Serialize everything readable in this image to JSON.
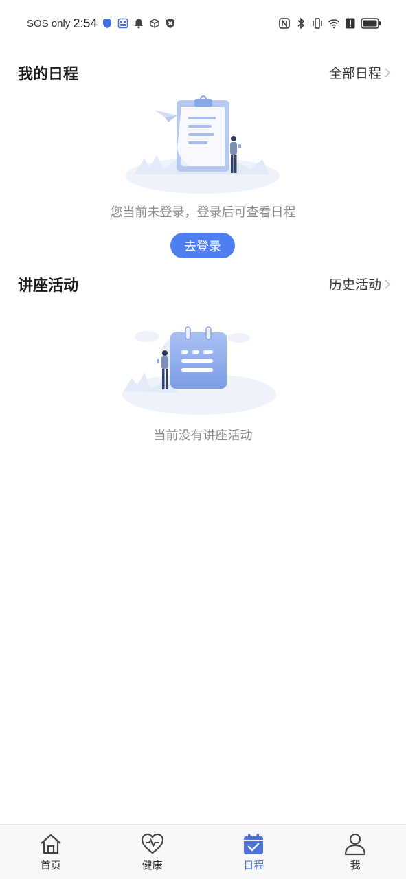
{
  "status_bar": {
    "carrier_text": "SOS only",
    "time": "2:54",
    "left_icons": [
      "shield-icon",
      "sim-card-icon",
      "bell-icon",
      "box-icon",
      "close-shield-icon"
    ],
    "right_icons": [
      "nfc-icon",
      "bluetooth-icon",
      "vibrate-icon",
      "wifi-icon",
      "alert-icon",
      "battery-icon"
    ]
  },
  "schedule": {
    "title": "我的日程",
    "link": "全部日程",
    "empty_text": "您当前未登录，登录后可查看日程",
    "login_button": "去登录"
  },
  "lectures": {
    "title": "讲座活动",
    "link": "历史活动",
    "empty_text": "当前没有讲座活动"
  },
  "bottom_nav": {
    "items": [
      {
        "label": "首页",
        "icon": "home-icon",
        "active": false
      },
      {
        "label": "健康",
        "icon": "heart-pulse-icon",
        "active": false
      },
      {
        "label": "日程",
        "icon": "calendar-check-icon",
        "active": true
      },
      {
        "label": "我",
        "icon": "user-icon",
        "active": false
      }
    ]
  },
  "colors": {
    "accent": "#4f7ef0",
    "active_nav": "#4a72d8",
    "muted_text": "#8a8a8a"
  }
}
